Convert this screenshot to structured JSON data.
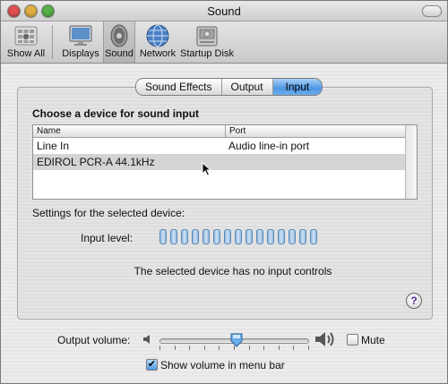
{
  "window": {
    "title": "Sound"
  },
  "toolbar": {
    "items": [
      {
        "label": "Show All",
        "icon": "apple-grid-icon"
      },
      {
        "label": "Displays",
        "icon": "display-icon"
      },
      {
        "label": "Sound",
        "icon": "speaker-icon",
        "selected": true
      },
      {
        "label": "Network",
        "icon": "globe-icon"
      },
      {
        "label": "Startup Disk",
        "icon": "disk-icon"
      }
    ]
  },
  "tabs": [
    {
      "label": "Sound Effects"
    },
    {
      "label": "Output"
    },
    {
      "label": "Input",
      "active": true
    }
  ],
  "input": {
    "heading": "Choose a device for sound input",
    "columns": {
      "name": "Name",
      "port": "Port"
    },
    "rows": [
      {
        "name": "Line In",
        "port": "Audio line-in port"
      },
      {
        "name": "EDIROL PCR-A 44.1kHz",
        "port": "",
        "selected": true
      }
    ],
    "settings_label": "Settings for the selected device:",
    "level_label": "Input level:",
    "level_bars": 15,
    "level_value": 0,
    "no_controls": "The selected device has no input controls",
    "help": "?"
  },
  "output": {
    "volume_label": "Output volume:",
    "volume_fraction": 0.52,
    "mute_label": "Mute",
    "mute_checked": false,
    "menu_bar_label": "Show volume in menu bar",
    "menu_bar_checked": true
  },
  "colors": {
    "accent": "#4f97e3",
    "selected_row": "#d4d4d4"
  }
}
